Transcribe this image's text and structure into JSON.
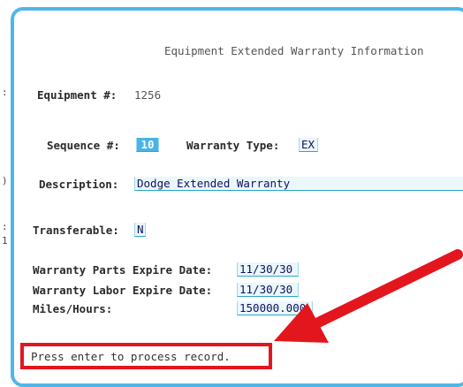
{
  "screen": {
    "title": "Equipment Extended Warranty Information",
    "equipment_label": "Equipment #:",
    "equipment_value": "1256",
    "sequence_label": "Sequence #:",
    "sequence_value": "10",
    "warranty_type_label": "Warranty Type:",
    "warranty_type_value": "EX",
    "description_label": "Description:",
    "description_value": "Dodge Extended Warranty",
    "transferable_label": "Transferable:",
    "transferable_value": "N",
    "parts_expire_label": "Warranty Parts Expire Date:",
    "parts_expire_value": "11/30/30",
    "labor_expire_label": "Warranty Labor Expire Date:",
    "labor_expire_value": "11/30/30",
    "miles_label": "Miles/Hours:",
    "miles_value": "150000.000"
  },
  "status": {
    "message": "Press enter to process record."
  },
  "annotation": {
    "color": "#e3161e"
  }
}
